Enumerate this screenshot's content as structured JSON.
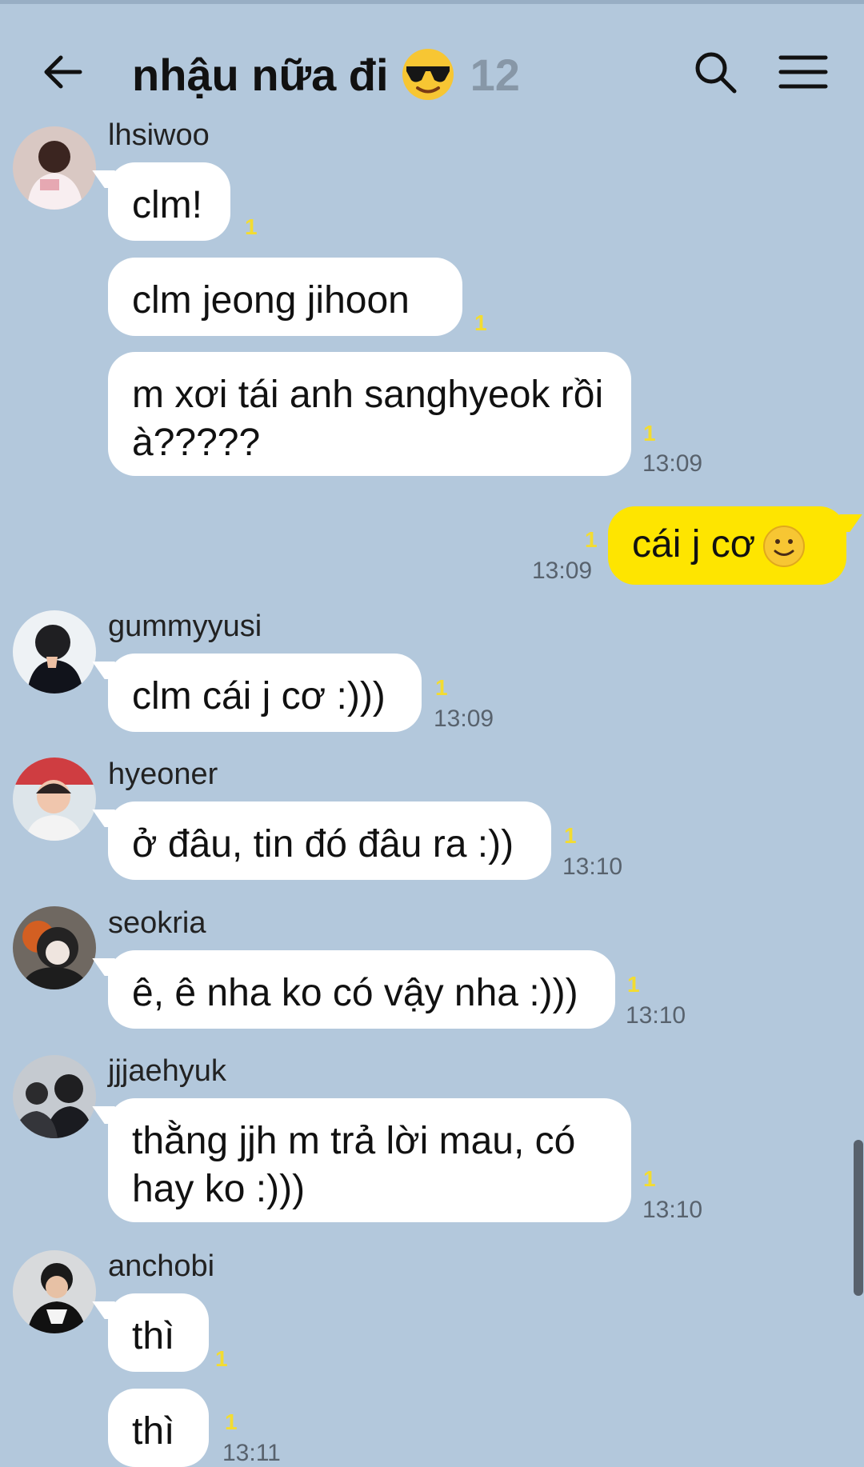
{
  "header": {
    "title": "nhậu nữa đi",
    "member_count": "12"
  },
  "messages": [
    {
      "sender": "lhsiwoo",
      "text": "clm!",
      "unread": "1",
      "time": ""
    },
    {
      "sender": "",
      "text": "clm jeong jihoon",
      "unread": "1",
      "time": ""
    },
    {
      "sender": "",
      "text": "m xơi tái anh sanghyeok rồi à?????",
      "unread": "1",
      "time": "13:09"
    },
    {
      "sender": "me",
      "text": "cái j cơ",
      "unread": "1",
      "time": "13:09"
    },
    {
      "sender": "gummyyusi",
      "text": "clm cái j cơ :)))",
      "unread": "1",
      "time": "13:09"
    },
    {
      "sender": "hyeoner",
      "text": "ở đâu, tin đó đâu ra :))",
      "unread": "1",
      "time": "13:10"
    },
    {
      "sender": "seokria",
      "text": "ê, ê nha ko có vậy nha :)))",
      "unread": "1",
      "time": "13:10"
    },
    {
      "sender": "jjjaehyuk",
      "text": "thằng jjh m trả lời mau, có hay ko :)))",
      "unread": "1",
      "time": "13:10"
    },
    {
      "sender": "anchobi",
      "text": "thì",
      "unread": "1",
      "time": ""
    },
    {
      "sender": "",
      "text": "thì",
      "unread": "1",
      "time": "13:11"
    }
  ],
  "icons": [
    "arrow-left-icon",
    "sunglasses-emoji-icon",
    "search-icon",
    "menu-icon",
    "smiling-emoji-icon"
  ],
  "colors": {
    "background": "#b3c8dc",
    "incoming_bubble": "#ffffff",
    "outgoing_bubble": "#fee500",
    "unread": "#f3dc31"
  }
}
